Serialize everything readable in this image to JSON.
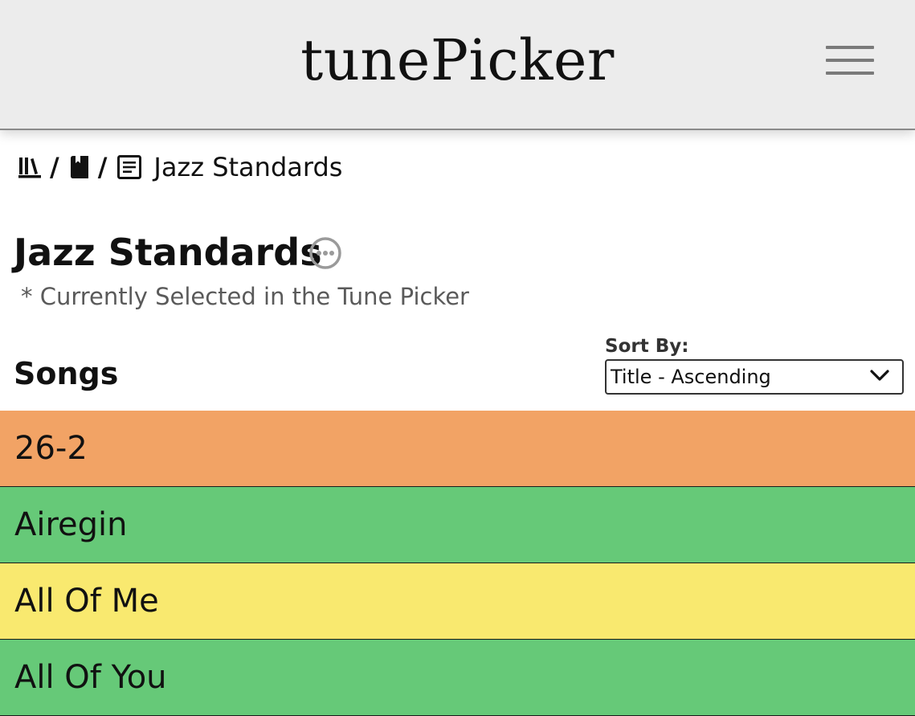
{
  "header": {
    "app_title": "tunePicker",
    "menu_icon": "hamburger-menu-icon"
  },
  "breadcrumb": {
    "items": [
      {
        "icon": "library-icon"
      },
      {
        "icon": "book-icon"
      },
      {
        "icon": "document-icon",
        "label": "Jazz Standards"
      }
    ],
    "separator": "/"
  },
  "page": {
    "title": "Jazz Standards",
    "more_icon": "more-options-icon",
    "subtitle": "* Currently Selected in the Tune Picker"
  },
  "songs_section": {
    "heading": "Songs",
    "sort": {
      "label": "Sort By:",
      "selected": "Title - Ascending"
    }
  },
  "songs": [
    {
      "title": "26-2",
      "color": "#f2a365"
    },
    {
      "title": "Airegin",
      "color": "#66c978"
    },
    {
      "title": "All Of Me",
      "color": "#f9e96f"
    },
    {
      "title": "All Of You",
      "color": "#66c978"
    }
  ],
  "colors": {
    "header_bg": "#ececec",
    "orange": "#f2a365",
    "green": "#66c978",
    "yellow": "#f9e96f"
  }
}
